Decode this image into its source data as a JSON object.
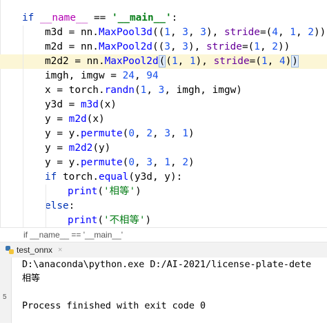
{
  "editor": {
    "lines": [
      {
        "indent": 0,
        "tokens": [
          {
            "t": "if ",
            "c": "kw"
          },
          {
            "t": "__name__",
            "c": "dunder"
          },
          {
            "t": " == ",
            "c": ""
          },
          {
            "t": "'__main__'",
            "c": "str"
          },
          {
            "t": ":",
            "c": ""
          }
        ]
      },
      {
        "indent": 1,
        "tokens": [
          {
            "t": "m3d = nn.",
            "c": ""
          },
          {
            "t": "MaxPool3d",
            "c": "fn"
          },
          {
            "t": "((",
            "c": ""
          },
          {
            "t": "1",
            "c": "num"
          },
          {
            "t": ", ",
            "c": ""
          },
          {
            "t": "3",
            "c": "num"
          },
          {
            "t": ", ",
            "c": ""
          },
          {
            "t": "3",
            "c": "num"
          },
          {
            "t": "), ",
            "c": ""
          },
          {
            "t": "stride",
            "c": "param"
          },
          {
            "t": "=(",
            "c": ""
          },
          {
            "t": "4",
            "c": "num"
          },
          {
            "t": ", ",
            "c": ""
          },
          {
            "t": "1",
            "c": "num"
          },
          {
            "t": ", ",
            "c": ""
          },
          {
            "t": "2",
            "c": "num"
          },
          {
            "t": "))",
            "c": ""
          }
        ]
      },
      {
        "indent": 1,
        "tokens": [
          {
            "t": "m2d = nn.",
            "c": ""
          },
          {
            "t": "MaxPool2d",
            "c": "fn"
          },
          {
            "t": "((",
            "c": ""
          },
          {
            "t": "3",
            "c": "num"
          },
          {
            "t": ", ",
            "c": ""
          },
          {
            "t": "3",
            "c": "num"
          },
          {
            "t": "), ",
            "c": ""
          },
          {
            "t": "stride",
            "c": "param"
          },
          {
            "t": "=(",
            "c": ""
          },
          {
            "t": "1",
            "c": "num"
          },
          {
            "t": ", ",
            "c": ""
          },
          {
            "t": "2",
            "c": "num"
          },
          {
            "t": "))",
            "c": ""
          }
        ]
      },
      {
        "indent": 1,
        "current": true,
        "tokens": [
          {
            "t": "m2d2 = nn.",
            "c": ""
          },
          {
            "t": "MaxPool2d",
            "c": "fn"
          },
          {
            "t": "(",
            "c": "paren-hl"
          },
          {
            "t": "(",
            "c": ""
          },
          {
            "t": "1",
            "c": "num"
          },
          {
            "t": ", ",
            "c": ""
          },
          {
            "t": "1",
            "c": "num"
          },
          {
            "t": "), ",
            "c": ""
          },
          {
            "t": "stride",
            "c": "param"
          },
          {
            "t": "=(",
            "c": ""
          },
          {
            "t": "1",
            "c": "num"
          },
          {
            "t": ", ",
            "c": ""
          },
          {
            "t": "4",
            "c": "num"
          },
          {
            "t": ")",
            "c": ""
          },
          {
            "t": ")",
            "c": "paren-hl"
          }
        ]
      },
      {
        "indent": 1,
        "tokens": [
          {
            "t": "imgh, imgw = ",
            "c": ""
          },
          {
            "t": "24",
            "c": "num"
          },
          {
            "t": ", ",
            "c": ""
          },
          {
            "t": "94",
            "c": "num"
          }
        ]
      },
      {
        "indent": 1,
        "tokens": [
          {
            "t": "x = torch.",
            "c": ""
          },
          {
            "t": "randn",
            "c": "fn"
          },
          {
            "t": "(",
            "c": ""
          },
          {
            "t": "1",
            "c": "num"
          },
          {
            "t": ", ",
            "c": ""
          },
          {
            "t": "3",
            "c": "num"
          },
          {
            "t": ", imgh, imgw)",
            "c": ""
          }
        ]
      },
      {
        "indent": 1,
        "tokens": [
          {
            "t": "y3d = ",
            "c": ""
          },
          {
            "t": "m3d",
            "c": "fn"
          },
          {
            "t": "(x)",
            "c": ""
          }
        ]
      },
      {
        "indent": 1,
        "tokens": [
          {
            "t": "y = ",
            "c": ""
          },
          {
            "t": "m2d",
            "c": "fn"
          },
          {
            "t": "(x)",
            "c": ""
          }
        ]
      },
      {
        "indent": 1,
        "tokens": [
          {
            "t": "y = y.",
            "c": ""
          },
          {
            "t": "permute",
            "c": "fn"
          },
          {
            "t": "(",
            "c": ""
          },
          {
            "t": "0",
            "c": "num"
          },
          {
            "t": ", ",
            "c": ""
          },
          {
            "t": "2",
            "c": "num"
          },
          {
            "t": ", ",
            "c": ""
          },
          {
            "t": "3",
            "c": "num"
          },
          {
            "t": ", ",
            "c": ""
          },
          {
            "t": "1",
            "c": "num"
          },
          {
            "t": ")",
            "c": ""
          }
        ]
      },
      {
        "indent": 1,
        "tokens": [
          {
            "t": "y = ",
            "c": ""
          },
          {
            "t": "m2d2",
            "c": "fn"
          },
          {
            "t": "(y)",
            "c": ""
          }
        ]
      },
      {
        "indent": 1,
        "tokens": [
          {
            "t": "y = y.",
            "c": ""
          },
          {
            "t": "permute",
            "c": "fn"
          },
          {
            "t": "(",
            "c": ""
          },
          {
            "t": "0",
            "c": "num"
          },
          {
            "t": ", ",
            "c": ""
          },
          {
            "t": "3",
            "c": "num"
          },
          {
            "t": ", ",
            "c": ""
          },
          {
            "t": "1",
            "c": "num"
          },
          {
            "t": ", ",
            "c": ""
          },
          {
            "t": "2",
            "c": "num"
          },
          {
            "t": ")",
            "c": ""
          }
        ]
      },
      {
        "indent": 1,
        "tokens": [
          {
            "t": "if ",
            "c": "kw"
          },
          {
            "t": "torch.",
            "c": ""
          },
          {
            "t": "equal",
            "c": "fn"
          },
          {
            "t": "(y3d, y):",
            "c": ""
          }
        ]
      },
      {
        "indent": 2,
        "tokens": [
          {
            "t": "print",
            "c": "fn"
          },
          {
            "t": "(",
            "c": ""
          },
          {
            "t": "'相等'",
            "c": "strn"
          },
          {
            "t": ")",
            "c": ""
          }
        ]
      },
      {
        "indent": 1,
        "tokens": [
          {
            "t": "else",
            "c": "kw"
          },
          {
            "t": ":",
            "c": ""
          }
        ]
      },
      {
        "indent": 2,
        "tokens": [
          {
            "t": "print",
            "c": "fn"
          },
          {
            "t": "(",
            "c": ""
          },
          {
            "t": "'不相等'",
            "c": "strn"
          },
          {
            "t": ")",
            "c": ""
          }
        ]
      }
    ]
  },
  "breadcrumb": {
    "text": "if __name__ == '__main__'"
  },
  "run": {
    "tab_label": "test_onnx",
    "close_glyph": "×",
    "console": [
      "D:\\anaconda\\python.exe D:/AI-2021/license-plate-dete",
      "相等",
      "",
      "Process finished with exit code 0"
    ]
  },
  "colors": {
    "keyword": "#0033b3",
    "function": "#0000ff",
    "number": "#1750eb",
    "string": "#067d17",
    "param": "#660099",
    "current_line": "#fcf6d6"
  },
  "icons": [
    "python-file-icon",
    "close-icon"
  ]
}
